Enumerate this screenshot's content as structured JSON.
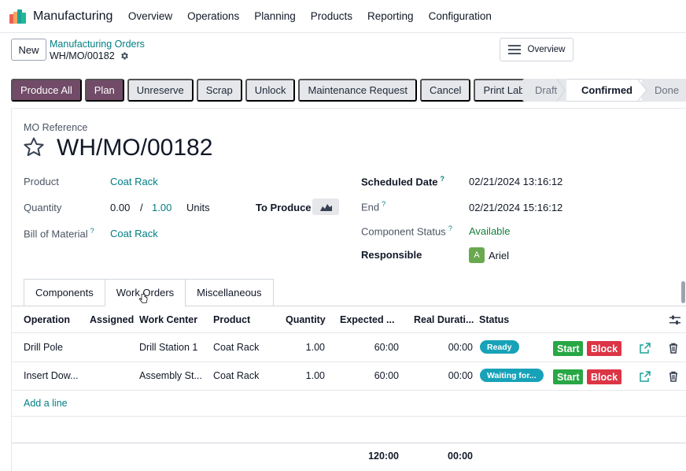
{
  "app": {
    "name": "Manufacturing",
    "menu": [
      "Overview",
      "Operations",
      "Planning",
      "Products",
      "Reporting",
      "Configuration"
    ],
    "logo_colors": [
      "#f06050",
      "#f4a460",
      "#1aa39a",
      "#21b799"
    ]
  },
  "control": {
    "new_label": "New",
    "breadcrumb_parent": "Manufacturing Orders",
    "breadcrumb_current": "WH/MO/00182",
    "overview_label": "Overview"
  },
  "actions": [
    "Produce All",
    "Plan",
    "Unreserve",
    "Scrap",
    "Unlock",
    "Maintenance Request",
    "Cancel",
    "Print Labels"
  ],
  "status": {
    "stages": [
      "Draft",
      "Confirmed",
      "Done"
    ],
    "current": "Confirmed"
  },
  "form": {
    "reference_label": "MO Reference",
    "reference": "WH/MO/00182",
    "product_label": "Product",
    "product": "Coat Rack",
    "quantity_label": "Quantity",
    "qty_produced": "0.00",
    "qty_sep": "/",
    "qty_total": "1.00",
    "qty_unit": "Units",
    "to_produce_label": "To Produce",
    "bom_label": "Bill of Material",
    "bom": "Coat Rack",
    "scheduled_label": "Scheduled Date",
    "scheduled": "02/21/2024 13:16:12",
    "end_label": "End",
    "end": "02/21/2024 15:16:12",
    "component_status_label": "Component Status",
    "component_status": "Available",
    "responsible_label": "Responsible",
    "responsible_initial": "A",
    "responsible": "Ariel",
    "help_mark": "?"
  },
  "tabs": [
    "Components",
    "Work Orders",
    "Miscellaneous"
  ],
  "active_tab": "Work Orders",
  "table": {
    "headers": [
      "Operation",
      "Assigned",
      "Work Center",
      "Product",
      "Quantity",
      "Expected ...",
      "Real Durati...",
      "Status"
    ],
    "rows": [
      {
        "operation": "Drill Pole",
        "assigned": "",
        "work_center": "Drill Station 1",
        "product": "Coat Rack",
        "quantity": "1.00",
        "expected": "60:00",
        "real": "00:00",
        "status": "Ready",
        "start": "Start",
        "block": "Block"
      },
      {
        "operation": "Insert Dow...",
        "assigned": "",
        "work_center": "Assembly St...",
        "product": "Coat Rack",
        "quantity": "1.00",
        "expected": "60:00",
        "real": "00:00",
        "status": "Waiting for...",
        "start": "Start",
        "block": "Block"
      }
    ],
    "add_line": "Add a line",
    "totals": {
      "expected": "120:00",
      "real": "00:00"
    }
  }
}
